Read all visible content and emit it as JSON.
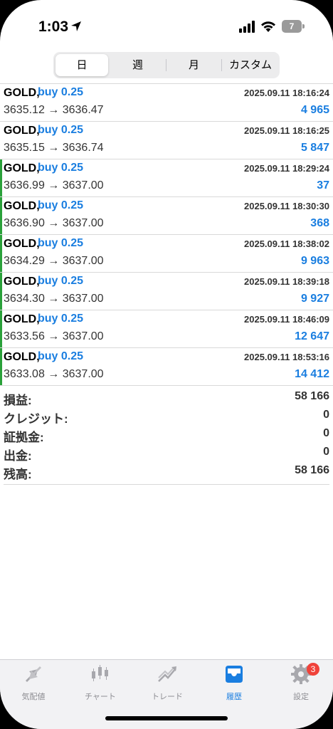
{
  "status": {
    "time": "1:03",
    "battery": "7"
  },
  "periods": [
    {
      "label": "日",
      "active": true
    },
    {
      "label": "週",
      "active": false
    },
    {
      "label": "月",
      "active": false
    },
    {
      "label": "カスタム",
      "active": false
    }
  ],
  "deals": [
    {
      "symbol": "GOLD,",
      "side": "buy 0.25",
      "time": "2025.09.11 18:16:24",
      "prices": "3635.12 → 3636.47",
      "profit": "4 965"
    },
    {
      "symbol": "GOLD,",
      "side": "buy 0.25",
      "time": "2025.09.11 18:16:25",
      "prices": "3635.15 → 3636.74",
      "profit": "5 847"
    },
    {
      "symbol": "GOLD,",
      "side": "buy 0.25",
      "time": "2025.09.11 18:29:24",
      "prices": "3636.99 → 3637.00",
      "profit": "37"
    },
    {
      "symbol": "GOLD,",
      "side": "buy 0.25",
      "time": "2025.09.11 18:30:30",
      "prices": "3636.90 → 3637.00",
      "profit": "368"
    },
    {
      "symbol": "GOLD,",
      "side": "buy 0.25",
      "time": "2025.09.11 18:38:02",
      "prices": "3634.29 → 3637.00",
      "profit": "9 963"
    },
    {
      "symbol": "GOLD,",
      "side": "buy 0.25",
      "time": "2025.09.11 18:39:18",
      "prices": "3634.30 → 3637.00",
      "profit": "9 927"
    },
    {
      "symbol": "GOLD,",
      "side": "buy 0.25",
      "time": "2025.09.11 18:46:09",
      "prices": "3633.56 → 3637.00",
      "profit": "12 647"
    },
    {
      "symbol": "GOLD,",
      "side": "buy 0.25",
      "time": "2025.09.11 18:53:16",
      "prices": "3633.08 → 3637.00",
      "profit": "14 412"
    }
  ],
  "summary": [
    {
      "label": "損益:",
      "value": "58 166"
    },
    {
      "label": "クレジット:",
      "value": "0"
    },
    {
      "label": "証拠金:",
      "value": "0"
    },
    {
      "label": "出金:",
      "value": "0"
    },
    {
      "label": "残高:",
      "value": "58 166"
    }
  ],
  "tabs": [
    {
      "label": "気配値",
      "icon": "quotes-icon",
      "active": false
    },
    {
      "label": "チャート",
      "icon": "candlestick-chart-icon",
      "active": false
    },
    {
      "label": "トレード",
      "icon": "trade-icon",
      "active": false
    },
    {
      "label": "履歴",
      "icon": "history-inbox-icon",
      "active": true
    },
    {
      "label": "設定",
      "icon": "gear-icon",
      "active": false,
      "badge": "3"
    }
  ],
  "colors": {
    "accent": "#1a7ee0",
    "closed_marker": "#2aa13a",
    "badge": "#f0423a"
  }
}
